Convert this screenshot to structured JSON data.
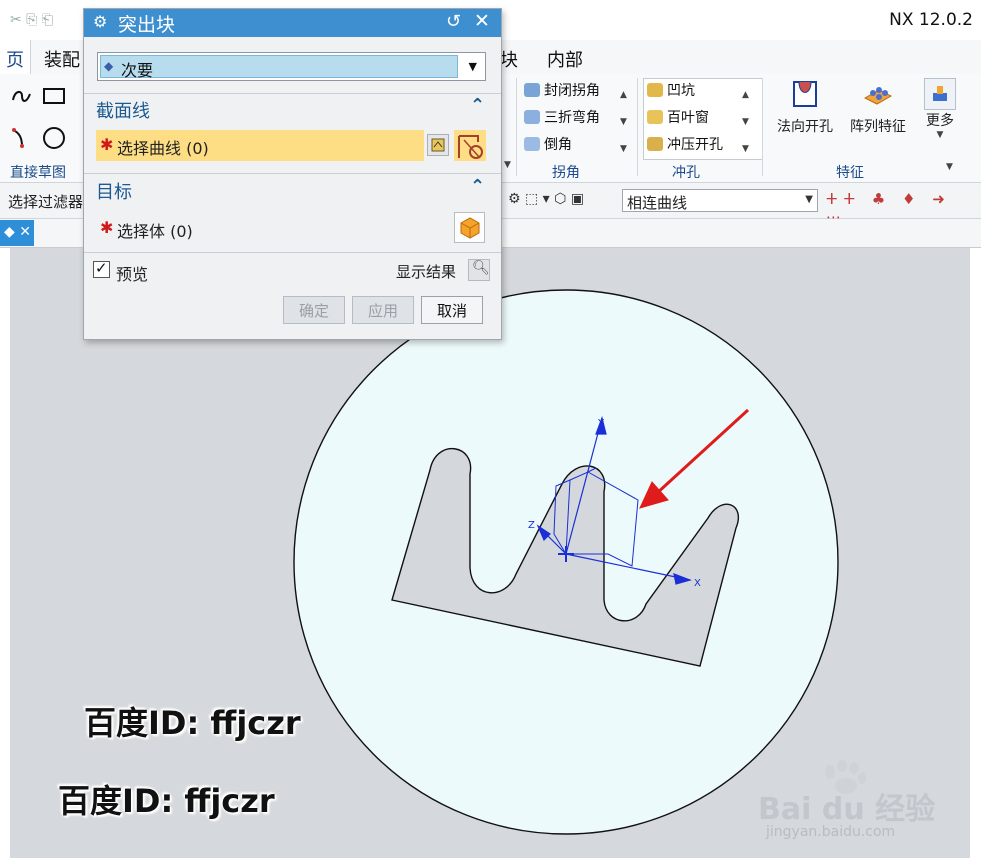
{
  "app": {
    "title": "NX 12.0.2",
    "menu": {
      "item_1": "页",
      "item_2": "装配",
      "item_3": "块",
      "item_4": "内部"
    }
  },
  "ribbon": {
    "left": {
      "group_label": "直接草图"
    },
    "corner": {
      "item_1": "封闭拐角",
      "item_2": "三折弯角",
      "item_3": "倒角",
      "group_label": "拐角"
    },
    "punch": {
      "item_1": "凹坑",
      "item_2": "百叶窗",
      "item_3": "冲压开孔",
      "group_label": "冲孔"
    },
    "feature": {
      "normal_cutout": "法向开孔",
      "pattern_feature": "阵列特征",
      "more": "更多",
      "group_label": "特征"
    },
    "more_fragment": "多"
  },
  "toolbar2": {
    "filter_label": "选择过滤器",
    "curve_rule": "相连曲线"
  },
  "dialog": {
    "title": "突出块",
    "type_value": "次要",
    "section_label": "截面线",
    "select_curve": "选择曲线 (0)",
    "target_label": "目标",
    "select_body": "选择体 (0)",
    "preview_label": "预览",
    "preview_checked": true,
    "show_result_label": "显示结果",
    "ok_label": "确定",
    "apply_label": "应用",
    "cancel_label": "取消"
  },
  "viewport": {
    "axis_x": "X",
    "axis_y": "Y",
    "axis_z": "Z",
    "plate_color": "#edfafb",
    "arrow_color": "#e01b1b",
    "csys_color": "#1a2fd6"
  },
  "watermark": {
    "line_1": "百度ID: ffjczr",
    "line_2": "百度ID: ffjczr",
    "brand": "Bai du 经验",
    "url": "jingyan.baidu.com"
  }
}
